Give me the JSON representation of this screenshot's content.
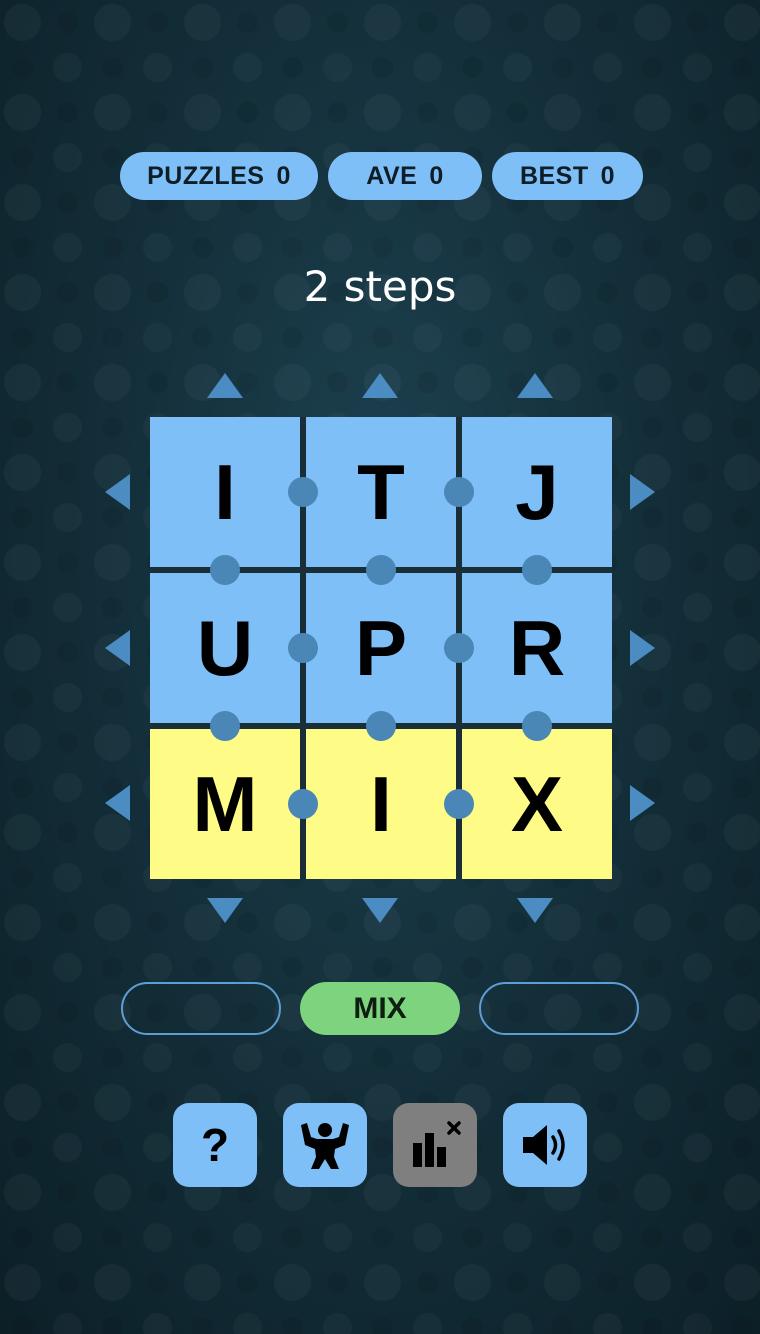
{
  "stats": {
    "puzzles": {
      "label": "PUZZLES",
      "value": "0"
    },
    "ave": {
      "label": "AVE",
      "value": "0"
    },
    "best": {
      "label": "BEST",
      "value": "0"
    }
  },
  "steps_text": "2 steps",
  "grid": {
    "rows": [
      [
        "I",
        "T",
        "J"
      ],
      [
        "U",
        "P",
        "R"
      ],
      [
        "M",
        "I",
        "X"
      ]
    ],
    "row_colors": [
      "blue",
      "blue",
      "yellow"
    ]
  },
  "buttons": {
    "mix_label": "MIX"
  },
  "toolbar": {
    "help": "?",
    "icons": [
      "question-icon",
      "strength-icon",
      "stats-off-icon",
      "speaker-icon"
    ]
  },
  "colors": {
    "tile_blue": "#7fbff7",
    "tile_yellow": "#fefc86",
    "arrow": "#4b8cc3",
    "mix_green": "#7ed47e",
    "disabled_gray": "#7f7f7f"
  }
}
